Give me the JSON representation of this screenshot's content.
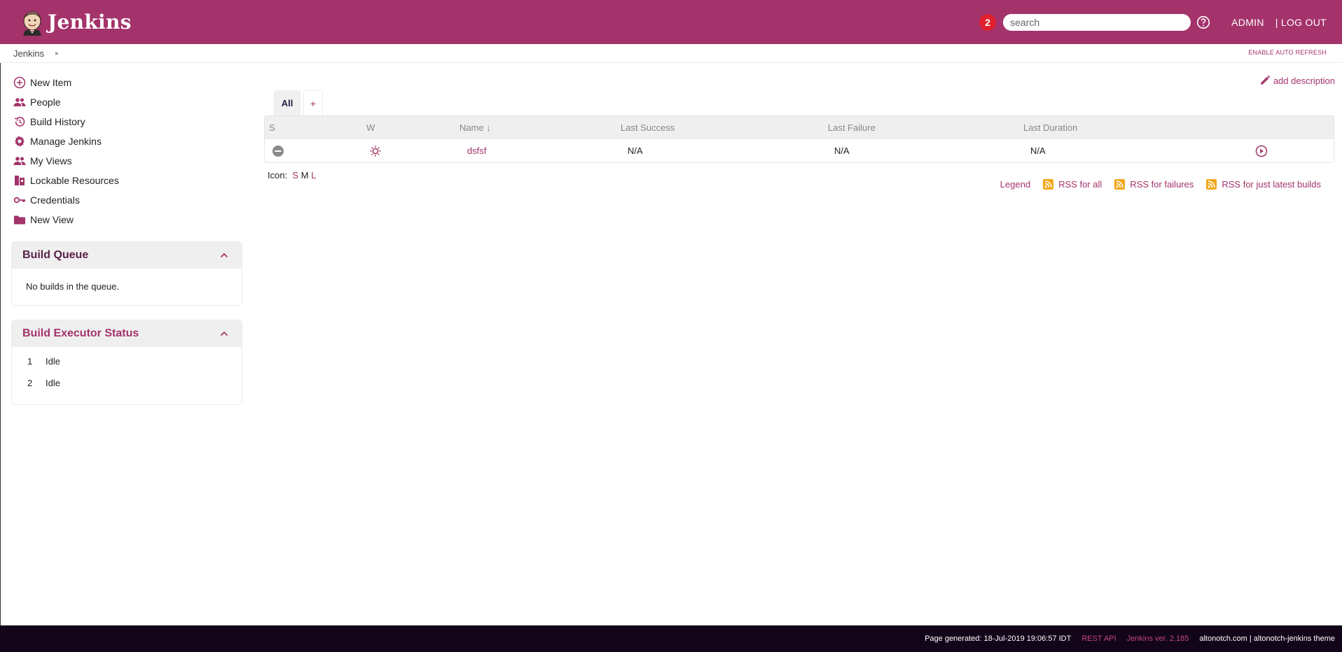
{
  "header": {
    "app_title": "Jenkins",
    "notification_count": "2",
    "search_placeholder": "search",
    "user_label": "ADMIN",
    "logout_label": "| LOG OUT"
  },
  "breadcrumb": {
    "root": "Jenkins",
    "auto_refresh": "ENABLE AUTO REFRESH"
  },
  "sidebar": {
    "tasks": [
      {
        "label": "New Item",
        "icon": "plus-circle-icon"
      },
      {
        "label": "People",
        "icon": "people-icon"
      },
      {
        "label": "Build History",
        "icon": "history-icon"
      },
      {
        "label": "Manage Jenkins",
        "icon": "gear-icon"
      },
      {
        "label": "My Views",
        "icon": "people-icon"
      },
      {
        "label": "Lockable Resources",
        "icon": "lock-resources-icon"
      },
      {
        "label": "Credentials",
        "icon": "key-icon"
      },
      {
        "label": "New View",
        "icon": "folder-icon"
      }
    ],
    "build_queue": {
      "title": "Build Queue",
      "empty_text": "No builds in the queue."
    },
    "executor_status": {
      "title": "Build Executor Status",
      "executors": [
        {
          "number": "1",
          "status": "Idle"
        },
        {
          "number": "2",
          "status": "Idle"
        }
      ]
    }
  },
  "main": {
    "add_description": "add description",
    "tabs": [
      {
        "label": "All",
        "active": true
      },
      {
        "label": "+",
        "active": false
      }
    ],
    "table": {
      "columns": [
        "S",
        "W",
        "Name ↓",
        "Last Success",
        "Last Failure",
        "Last Duration"
      ],
      "rows": [
        {
          "name": "dsfsf",
          "last_success": "N/A",
          "last_failure": "N/A",
          "last_duration": "N/A"
        }
      ]
    },
    "icon_size": {
      "label": "Icon:",
      "options": [
        "S",
        "M",
        "L"
      ],
      "current": "M"
    },
    "feed_links": {
      "legend": "Legend",
      "rss_all": "RSS for all",
      "rss_failures": "RSS for failures",
      "rss_latest": "RSS for just latest builds"
    }
  },
  "footer": {
    "page_generated": "Page generated: 18-Jul-2019 19:06:57 IDT",
    "rest_api": "REST API",
    "version": "Jenkins ver. 2.185",
    "theme": "altonotch.com | altonotch-jenkins theme"
  },
  "colors": {
    "brand": "#a3336a",
    "footer_bg": "#12051a",
    "notification": "#e0202e",
    "rss": "#f2a71c"
  }
}
